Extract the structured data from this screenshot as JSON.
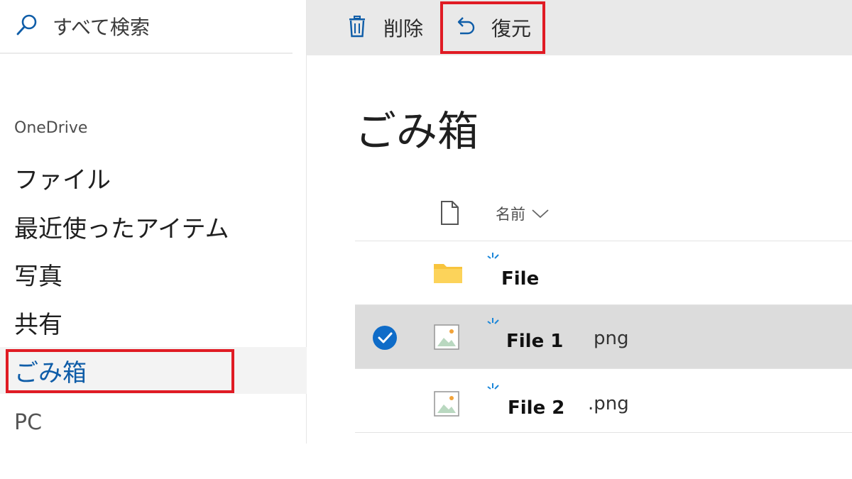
{
  "sidebar": {
    "search_placeholder": "すべて検索",
    "section_label": "OneDrive",
    "items": [
      {
        "label": "ファイル"
      },
      {
        "label": "最近使ったアイテム"
      },
      {
        "label": "写真"
      },
      {
        "label": "共有"
      },
      {
        "label": "ごみ箱",
        "active": true
      },
      {
        "label": "PC"
      }
    ]
  },
  "commandbar": {
    "delete_label": "削除",
    "restore_label": "復元"
  },
  "main": {
    "title": "ごみ箱",
    "column_name": "名前",
    "files": [
      {
        "name": "File",
        "ext": "",
        "type": "folder",
        "selected": false
      },
      {
        "name": "File 1",
        "ext": "png",
        "type": "image",
        "selected": true
      },
      {
        "name": "File 2",
        "ext": ".png",
        "type": "image",
        "selected": false
      }
    ]
  },
  "colors": {
    "accent": "#0f5da8",
    "highlight_box": "#e01b24",
    "commandbar_bg": "#e9e9e9",
    "folder": "#f8c43d",
    "selected_row": "#dcdcdc"
  }
}
